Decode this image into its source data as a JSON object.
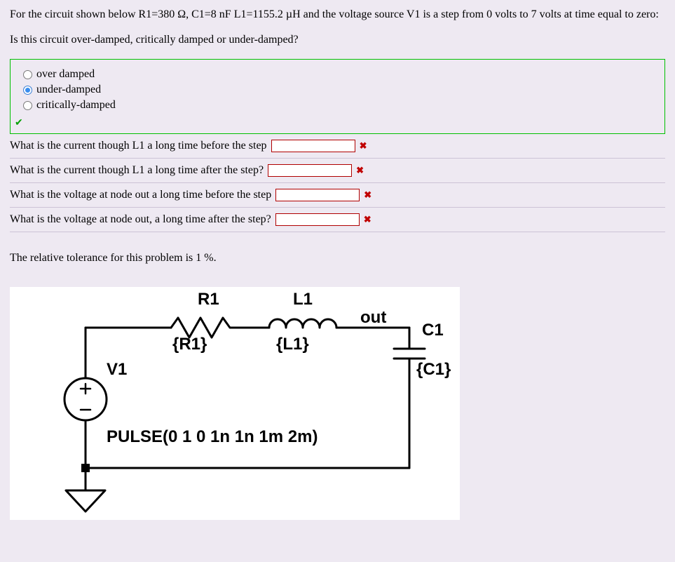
{
  "problem": {
    "intro": "For the circuit shown below R1=380 Ω, C1=8 nF L1=1155.2 µH and the voltage source V1 is a step from 0 volts to 7 volts at time equal to zero:",
    "question": "Is this circuit over-damped, critically damped or under-damped?"
  },
  "radio_options": [
    {
      "label": "over damped",
      "selected": false
    },
    {
      "label": "under-damped",
      "selected": true
    },
    {
      "label": "critically-damped",
      "selected": false
    }
  ],
  "sub_questions": [
    {
      "text": "What is the current though L1 a long time before the step",
      "value": ""
    },
    {
      "text": "What is the current though L1 a long time after the step?",
      "value": ""
    },
    {
      "text": "What is the voltage at node out a long time before the step",
      "value": ""
    },
    {
      "text": "What is the voltage at node out, a long time after the step?",
      "value": ""
    }
  ],
  "tolerance_text": "The relative tolerance for this problem is 1 %.",
  "circuit": {
    "labels": {
      "R1": "R1",
      "R1_val": "{R1}",
      "L1": "L1",
      "L1_val": "{L1}",
      "out": "out",
      "C1": "C1",
      "C1_val": "{C1}",
      "V1": "V1",
      "pulse": "PULSE(0 1 0 1n 1n 1m 2m)"
    }
  }
}
